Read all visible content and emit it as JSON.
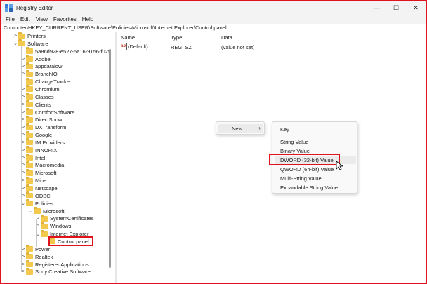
{
  "window": {
    "title": "Registry Editor",
    "controls": [
      "—",
      "☐",
      "✕"
    ]
  },
  "menu": [
    "File",
    "Edit",
    "View",
    "Favorites",
    "Help"
  ],
  "address": "Computer\\HKEY_CURRENT_USER\\Software\\Policies\\Microsoft\\Internet Explorer\\Control panel",
  "tree": [
    {
      "label": "Printers",
      "chev": ">"
    },
    {
      "label": "Software",
      "chev": "v"
    },
    {
      "label": "5a86d928-e527-5a16-9156-f025",
      "chev": ""
    },
    {
      "label": "Adobe",
      "chev": ">"
    },
    {
      "label": "appdatalow",
      "chev": ">"
    },
    {
      "label": "BranchIO",
      "chev": ">"
    },
    {
      "label": "ChangeTracker",
      "chev": ""
    },
    {
      "label": "Chromium",
      "chev": ">"
    },
    {
      "label": "Classes",
      "chev": ">"
    },
    {
      "label": "Clients",
      "chev": ">"
    },
    {
      "label": "ComfortSoftware",
      "chev": ">"
    },
    {
      "label": "DirectShow",
      "chev": ">"
    },
    {
      "label": "DXTransform",
      "chev": ">"
    },
    {
      "label": "Google",
      "chev": ">"
    },
    {
      "label": "IM Providers",
      "chev": ">"
    },
    {
      "label": "INNORIX",
      "chev": ">"
    },
    {
      "label": "Intel",
      "chev": ">"
    },
    {
      "label": "Macromedia",
      "chev": ">"
    },
    {
      "label": "Microsoft",
      "chev": ">"
    },
    {
      "label": "Mine",
      "chev": ">"
    },
    {
      "label": "Netscape",
      "chev": ">"
    },
    {
      "label": "ODBC",
      "chev": ">"
    },
    {
      "label": "Policies",
      "chev": "v"
    },
    {
      "label": "Microsoft",
      "chev": "v"
    },
    {
      "label": "SystemCertificates",
      "chev": ">"
    },
    {
      "label": "Windows",
      "chev": ">"
    },
    {
      "label": "Internet Explorer",
      "chev": "v"
    },
    {
      "label": "Control panel",
      "chev": ""
    },
    {
      "label": "Power",
      "chev": ">"
    },
    {
      "label": "Realtek",
      "chev": ">"
    },
    {
      "label": "RegisteredApplications",
      "chev": ">"
    },
    {
      "label": "Sony Creative Software",
      "chev": ">"
    }
  ],
  "list": {
    "headers": {
      "name": "Name",
      "type": "Type",
      "data": "Data"
    },
    "rows": [
      {
        "icon": "ab",
        "name": "(Default)",
        "type": "REG_SZ",
        "data": "(value not set)"
      }
    ]
  },
  "context_menu": {
    "new_label": "New",
    "arrow": "›",
    "submenu": [
      "Key",
      "String Value",
      "Binary Value",
      "DWORD (32-bit) Value",
      "QWORD (64-bit) Value",
      "Multi-String Value",
      "Expandable String Value"
    ]
  },
  "colors": {
    "highlight": "#e0121b",
    "folder": "#f2c94c"
  }
}
